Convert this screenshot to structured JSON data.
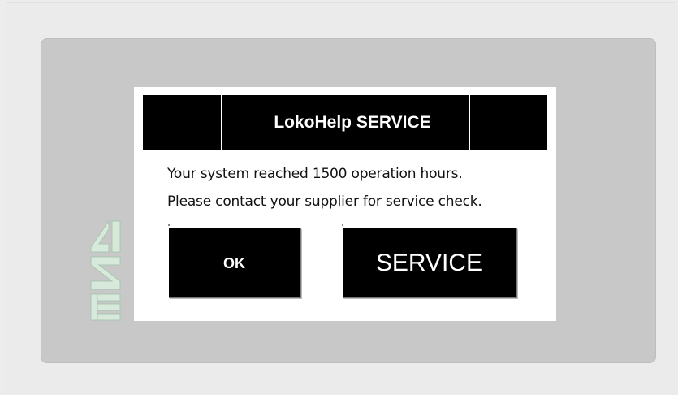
{
  "dialog": {
    "title": "LokoHelp SERVICE",
    "message_line1": "Your system reached 1500 operation hours.",
    "message_line2": "Please contact your supplier for service check.",
    "ok_label": "OK",
    "service_label": "SERVICE"
  },
  "logo": {
    "icon": "brand-logo-icon"
  },
  "colors": {
    "background": "#ececec",
    "panel": "#c8c8c8",
    "dialog": "#ffffff",
    "header": "#000000",
    "button": "#000000",
    "logo": "#d2e6d8"
  }
}
